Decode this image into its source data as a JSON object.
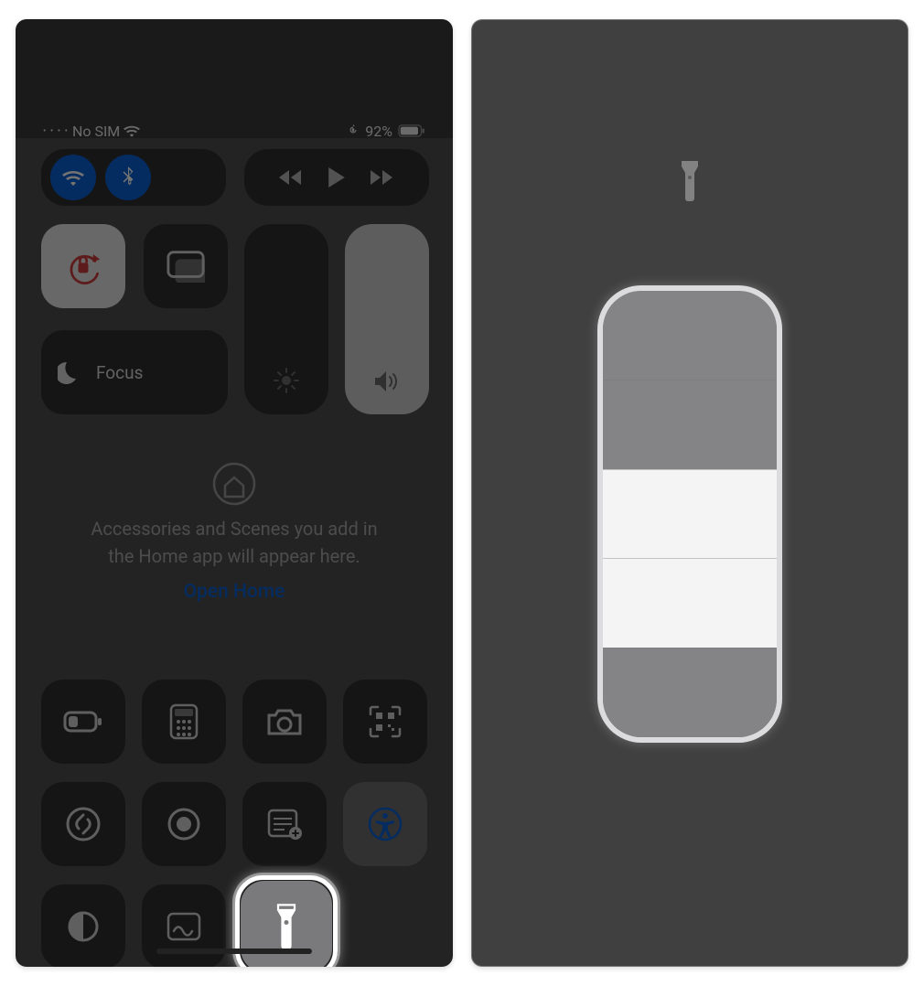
{
  "statusbar": {
    "carrier": "No SIM",
    "battery_pct": "92%"
  },
  "focus": {
    "label": "Focus"
  },
  "home": {
    "hint_line1": "Accessories and Scenes you add in",
    "hint_line2": "the Home app will appear here.",
    "open_label": "Open Home"
  },
  "flashlight_slider": {
    "levels": 4,
    "level": 2
  },
  "icons": {
    "wifi": "wifi-icon",
    "bluetooth": "bluetooth-icon",
    "orientationLock": "orientation-lock-icon",
    "screenMirror": "screen-mirror-icon",
    "moon": "moon-icon",
    "brightness": "brightness-icon",
    "volume": "speaker-icon",
    "home": "home-icon",
    "lowPower": "battery-icon",
    "calculator": "calculator-icon",
    "camera": "camera-icon",
    "qr": "qr-scanner-icon",
    "shazam": "shazam-icon",
    "record": "screen-record-icon",
    "notes": "quick-note-icon",
    "accessibility": "accessibility-icon",
    "darkmode": "dark-mode-icon",
    "freeform": "freeform-icon",
    "flashlight": "flashlight-icon"
  },
  "colors": {
    "accent_blue": "#0a63d6",
    "lock_red": "#d13d3d",
    "tile_dark": "#2f2f30",
    "tile_white": "#e6e6e7"
  }
}
